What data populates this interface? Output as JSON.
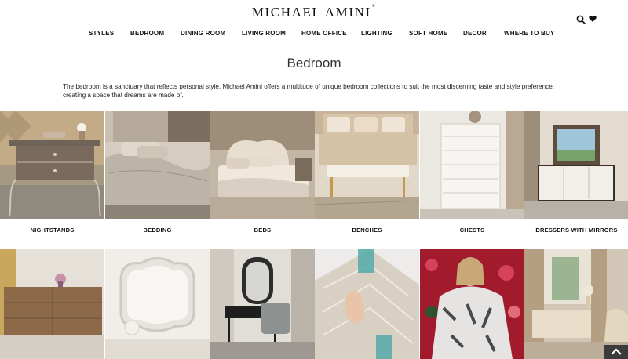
{
  "header": {
    "logo_text": "MICHAEL AMINI",
    "logo_mark": "®",
    "icons": [
      "search-icon",
      "heart-icon"
    ]
  },
  "nav": {
    "items": [
      {
        "label": "STYLES"
      },
      {
        "label": "BEDROOM"
      },
      {
        "label": "DINING ROOM"
      },
      {
        "label": "LIVING ROOM"
      },
      {
        "label": "HOME OFFICE"
      },
      {
        "label": "LIGHTING"
      },
      {
        "label": "SOFT HOME"
      },
      {
        "label": "DECOR"
      },
      {
        "label": "WHERE TO BUY"
      }
    ]
  },
  "page": {
    "title": "Bedroom",
    "intro": "The bedroom is a sanctuary that reflects personal style. Michael Amini offers a multitude of unique bedroom collections to suit the most discerning taste and style preference, creating a space that dreams are made of."
  },
  "categories": {
    "row1": [
      {
        "label": "NIGHTSTANDS"
      },
      {
        "label": "BEDDING"
      },
      {
        "label": "BEDS"
      },
      {
        "label": "BENCHES"
      },
      {
        "label": "CHESTS"
      },
      {
        "label": "DRESSERS WITH MIRRORS"
      }
    ],
    "row2_images": [
      "dresser-photo",
      "mirror-photo",
      "vanity-photo",
      "pillow-photo",
      "throw-blanket-photo",
      "bedroom-suite-photo"
    ]
  },
  "colors": {
    "text": "#111111",
    "underline": "#9a9a9a",
    "scroll_button": "#3b3b3b"
  }
}
